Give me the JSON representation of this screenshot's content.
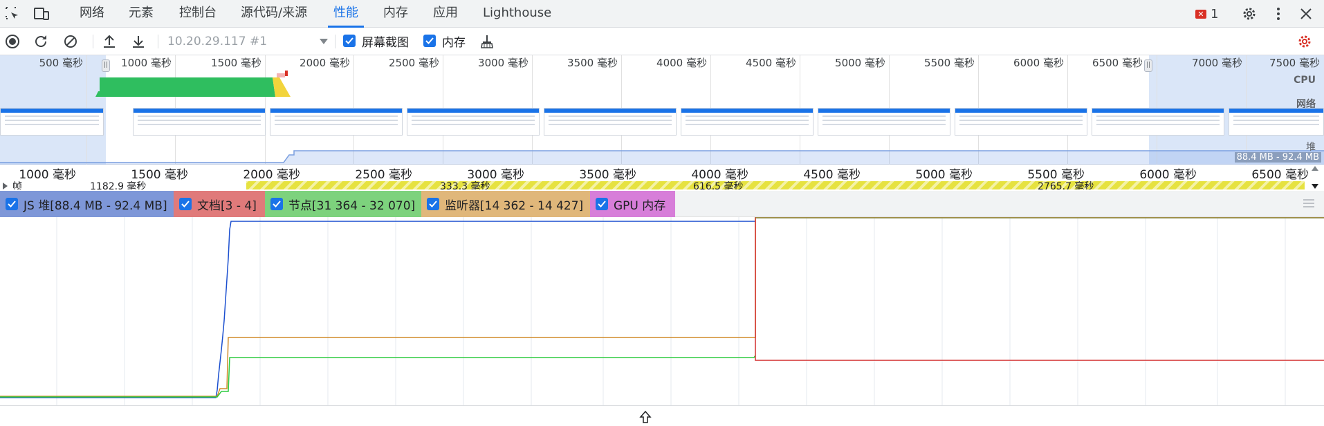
{
  "tabs": [
    {
      "label": "网络"
    },
    {
      "label": "元素"
    },
    {
      "label": "控制台"
    },
    {
      "label": "源代码/来源"
    },
    {
      "label": "性能"
    },
    {
      "label": "内存"
    },
    {
      "label": "应用"
    },
    {
      "label": "Lighthouse"
    }
  ],
  "active_tab": "性能",
  "error_count": "1",
  "toolbar": {
    "profile": "10.20.29.117 #1",
    "screenshots_label": "屏幕截图",
    "memory_label": "内存"
  },
  "overview": {
    "ticks": [
      "500 毫秒",
      "1000 毫秒",
      "1500 毫秒",
      "2000 毫秒",
      "2500 毫秒",
      "3000 毫秒",
      "3500 毫秒",
      "4000 毫秒",
      "4500 毫秒",
      "5000 毫秒",
      "5500 毫秒",
      "6000 毫秒",
      "6500 毫秒",
      "7000 毫秒",
      "7500 毫秒"
    ],
    "cpu_label": "CPU",
    "net_label": "网络",
    "heap_label": "堆",
    "heap_range": "88.4 MB - 92.4 MB"
  },
  "ruler": {
    "ticks": [
      "1000 毫秒",
      "1500 毫秒",
      "2000 毫秒",
      "2500 毫秒",
      "3000 毫秒",
      "3500 毫秒",
      "4000 毫秒",
      "4500 毫秒",
      "5000 毫秒",
      "5500 毫秒",
      "6000 毫秒",
      "6500 毫秒"
    ]
  },
  "frames": {
    "label": "帧",
    "durations": [
      "1182.9 毫秒",
      "333.3 毫秒",
      "616.5 毫秒",
      "2765.7 毫秒"
    ]
  },
  "legend": [
    {
      "label": "JS 堆[88.4 MB - 92.4 MB]",
      "color": "#7e97d8"
    },
    {
      "label": "文档[3 - 4]",
      "color": "#e07a7a"
    },
    {
      "label": "节点[31 364 - 32 070]",
      "color": "#7dd27d"
    },
    {
      "label": "监听器[14 362 - 14 427]",
      "color": "#e0b77a"
    },
    {
      "label": "GPU 内存",
      "color": "#d77ed9"
    }
  ],
  "colors": {
    "accent": "#1a73e8",
    "js_heap_line": "#1b4fcf",
    "documents_line": "#d32f2f",
    "nodes_line": "#2ecc40",
    "listeners_line": "#d08b2a",
    "gpu_line": "#8b8b4a"
  }
}
